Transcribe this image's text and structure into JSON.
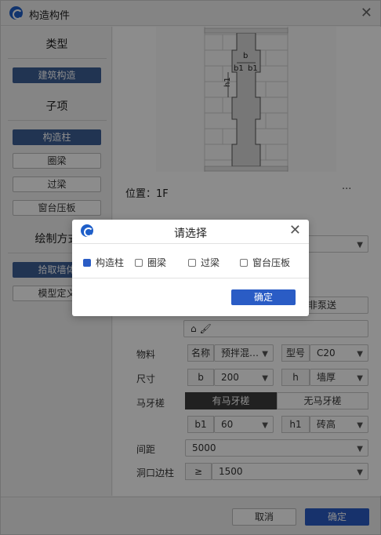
{
  "window": {
    "title": "构造构件"
  },
  "left": {
    "type_title": "类型",
    "type_button": "建筑构造",
    "sub_title": "子项",
    "sub_items": [
      "构造柱",
      "圈梁",
      "过梁",
      "窗台压板"
    ],
    "draw_title": "绘制方式",
    "draw_items": [
      "拾取墙体",
      "模型定义"
    ]
  },
  "right": {
    "drawing_labels": {
      "b": "b",
      "b1a": "b1",
      "b1b": "b1",
      "h1": "h1"
    },
    "position_label": "位置：1F",
    "more": "···",
    "pump_label": "非泵送",
    "material": {
      "label": "物料",
      "tag_name": "名称",
      "name_value": "预拌混…",
      "tag_model": "型号",
      "model_value": "C20"
    },
    "size": {
      "label": "尺寸",
      "b_tag": "b",
      "b_value": "200",
      "h_tag": "h",
      "h_value": "墙厚"
    },
    "horse": {
      "label": "马牙槎",
      "on": "有马牙槎",
      "off": "无马牙槎"
    },
    "horse_dims": {
      "b1_tag": "b1",
      "b1_value": "60",
      "h1_tag": "h1",
      "h1_value": "砖高"
    },
    "spacing": {
      "label": "间距",
      "value": "5000"
    },
    "opening": {
      "label": "洞口边柱",
      "tag": "≥",
      "value": "1500"
    }
  },
  "bottom": {
    "cancel": "取消",
    "confirm": "确定"
  },
  "dialog": {
    "title": "请选择",
    "options": [
      {
        "label": "构造柱",
        "checked": true
      },
      {
        "label": "圈梁",
        "checked": false
      },
      {
        "label": "过梁",
        "checked": false
      },
      {
        "label": "窗台压板",
        "checked": false
      }
    ],
    "ok": "确定"
  }
}
